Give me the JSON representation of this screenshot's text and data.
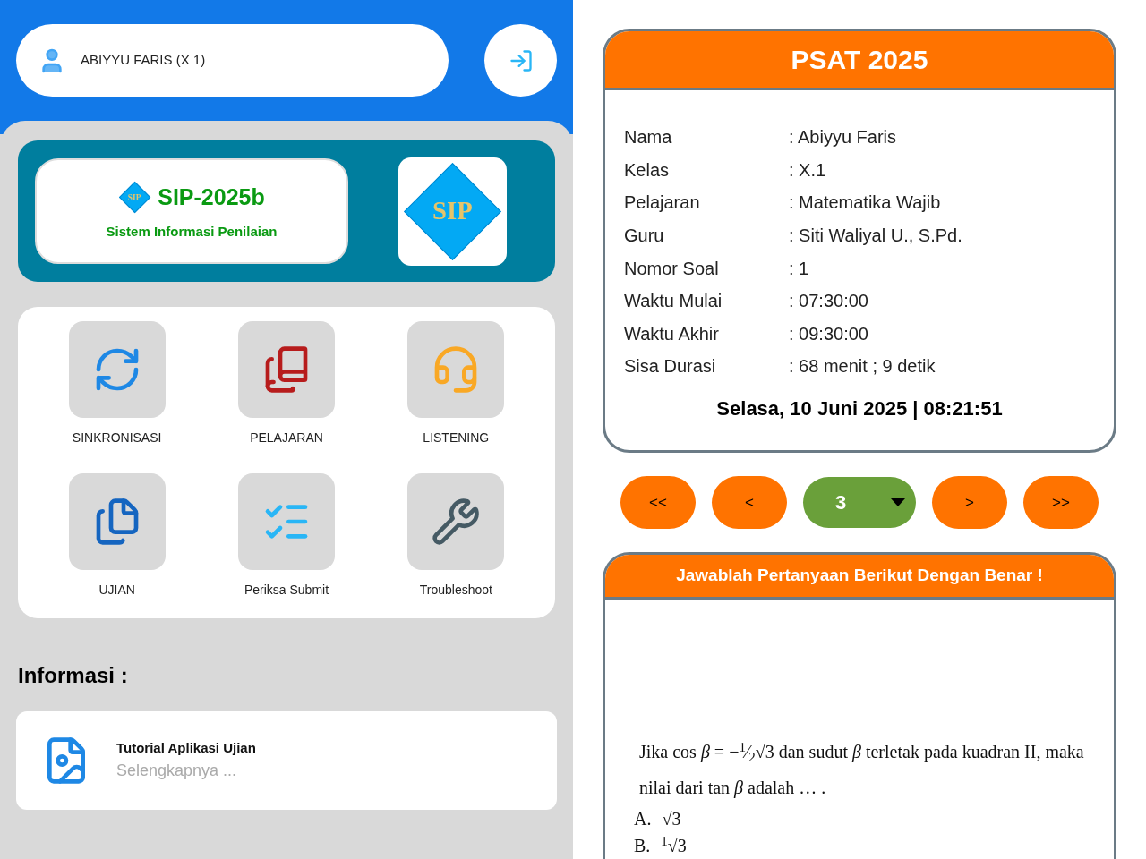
{
  "user": {
    "name": "ABIYYU FARIS (X 1)"
  },
  "banner": {
    "title": "SIP-2025b",
    "subtitle": "Sistem Informasi Penilaian",
    "logo_text": "SIP",
    "small_logo_text": "SIP"
  },
  "menu": [
    {
      "label": "SINKRONISASI",
      "kind": "sync"
    },
    {
      "label": "PELAJARAN",
      "kind": "books"
    },
    {
      "label": "LISTENING",
      "kind": "headset"
    },
    {
      "label": "UJIAN",
      "kind": "exam"
    },
    {
      "label": "Periksa Submit",
      "kind": "list"
    },
    {
      "label": "Troubleshoot",
      "kind": "wrench"
    }
  ],
  "info": {
    "heading": "Informasi :",
    "items": [
      {
        "title": "Tutorial Aplikasi Ujian",
        "link": "Selengkapnya ..."
      }
    ]
  },
  "exam": {
    "title": "PSAT 2025",
    "fields": [
      {
        "label": "Nama",
        "value": ": Abiyyu Faris"
      },
      {
        "label": "Kelas",
        "value": ": X.1"
      },
      {
        "label": "Pelajaran",
        "value": ": Matematika Wajib"
      },
      {
        "label": "Guru",
        "value": ": Siti Waliyal U., S.Pd."
      },
      {
        "label": "Nomor Soal",
        "value": ": 1"
      },
      {
        "label": "Waktu Mulai",
        "value": ": 07:30:00"
      },
      {
        "label": "Waktu Akhir",
        "value": ": 09:30:00"
      },
      {
        "label": "Sisa Durasi",
        "value": ": 68 menit ; 9 detik"
      }
    ],
    "datetime": "Selasa, 10 Juni 2025 | 08:21:51"
  },
  "pagination": {
    "first": "<<",
    "prev": "<",
    "page": "3",
    "next": ">",
    "last": ">>"
  },
  "question": {
    "header": "Jawablah Pertanyaan Berikut Dengan Benar !",
    "text": "Jika cos *β* = −$^{1}$⁄$_{2}$√3 dan sudut *β* terletak pada kuadran II, maka nilai dari tan *β* adalah … .",
    "options": [
      {
        "letter": "A.",
        "text": "√3"
      },
      {
        "letter": "B.",
        "text": "$^{1}$√3"
      }
    ]
  }
}
